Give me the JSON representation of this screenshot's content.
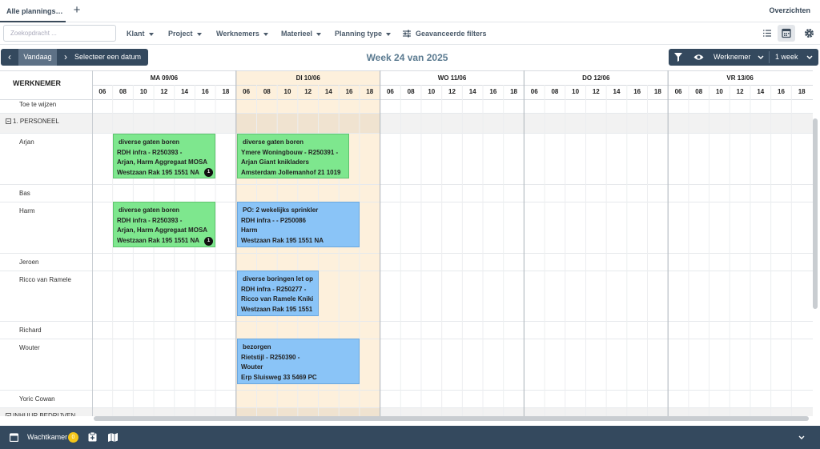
{
  "tabs": {
    "active": "Alle plannings…",
    "add": "+",
    "overview": "Overzichten"
  },
  "filters": {
    "search_placeholder": "Zoekopdracht ...",
    "items": [
      "Klant",
      "Project",
      "Werknemers",
      "Materieel",
      "Planning type"
    ],
    "advanced": "Geavanceerde filters"
  },
  "nav": {
    "prev": "‹",
    "today": "Vandaag",
    "next": "›",
    "select_date": "Selecteer een datum",
    "week_title": "Week 24 van 2025",
    "group_by": "Werknemer",
    "range": "1 week"
  },
  "grid": {
    "employee_header": "WERKNEMER",
    "days": [
      "MA 09/06",
      "DI 10/06",
      "WO 11/06",
      "DO 12/06",
      "VR 13/06"
    ],
    "hours": [
      "06",
      "08",
      "10",
      "12",
      "14",
      "16",
      "18"
    ],
    "rows": [
      {
        "type": "emp",
        "name": "Toe te wijzen"
      },
      {
        "type": "group",
        "name": "1. PERSONEEL"
      },
      {
        "type": "emp",
        "name": "Arjan"
      },
      {
        "type": "emp",
        "name": "Bas"
      },
      {
        "type": "emp",
        "name": "Harm"
      },
      {
        "type": "emp",
        "name": "Jeroen"
      },
      {
        "type": "emp",
        "name": "Ricco van Ramele"
      },
      {
        "type": "emp",
        "name": "Richard"
      },
      {
        "type": "emp",
        "name": "Wouter"
      },
      {
        "type": "emp",
        "name": "Yoric Cowan"
      },
      {
        "type": "group",
        "name": "INHUUR BEDRIJVEN"
      }
    ]
  },
  "events": [
    {
      "color": "green",
      "lines": [
        "diverse gaten boren",
        "RDH infra - R250393 -",
        "Arjan, Harm Aggregaat MOSA",
        "Westzaan Rak 195 1551 NA"
      ],
      "badge": "1"
    },
    {
      "color": "green",
      "lines": [
        "diverse gaten boren",
        "Ymere Woningbouw - R250391 -",
        "Arjan Giant knikladers",
        "Amsterdam Jollemanhof 21 1019"
      ],
      "badge": ""
    },
    {
      "color": "green",
      "lines": [
        "diverse gaten boren",
        "RDH infra - R250393 -",
        "Arjan, Harm Aggregaat MOSA",
        "Westzaan Rak 195 1551 NA"
      ],
      "badge": "1"
    },
    {
      "color": "blue",
      "lines": [
        "PO: 2 wekelijks sprinkler",
        "RDH infra - - P250086",
        "Harm",
        "Westzaan Rak 195 1551 NA"
      ],
      "badge": ""
    },
    {
      "color": "blue",
      "lines": [
        "diverse boringen let op",
        "RDH infra - R250277 -",
        "Ricco van Ramele Kniki",
        "Westzaan Rak 195 1551"
      ],
      "badge": ""
    },
    {
      "color": "blue",
      "lines": [
        "bezorgen",
        "Rietstijl - R250390 -",
        "Wouter",
        "Erp Sluisweg 33 5469 PC"
      ],
      "badge": ""
    }
  ],
  "bottom": {
    "label": "Wachtkamer",
    "count": "0"
  },
  "colors": {
    "dark": "#34495e",
    "today_bg": "#fdf0dc",
    "green": "#7ee78e",
    "blue": "#8ac4f7"
  }
}
